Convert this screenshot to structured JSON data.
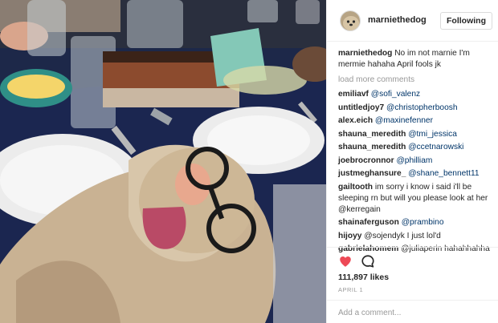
{
  "post": {
    "username": "marniethedog",
    "follow_label": "Following",
    "avatar_icon": "dog-avatar-icon",
    "caption": {
      "user": "marniethedog",
      "text": "No im not marnie I'm mermie hahaha April fools jk"
    },
    "load_more": "load more comments",
    "comments": [
      {
        "user": "emiliavf",
        "text": "@sofi_valenz"
      },
      {
        "user": "untitledjoy7",
        "text": "@christopherboosh"
      },
      {
        "user": "alex.eich",
        "text": "@maxinefenner"
      },
      {
        "user": "shauna_meredith",
        "text": "@tmi_jessica"
      },
      {
        "user": "shauna_meredith",
        "text": "@ccetnarowski"
      },
      {
        "user": "joebrocronnor",
        "text": "@philliam"
      },
      {
        "user": "justmeghansure_",
        "text": "@shane_bennett11"
      },
      {
        "user": "gailtooth",
        "text": "im sorry i know i said i'll be sleeping rn but will you please look at her @kerregain"
      },
      {
        "user": "shainaferguson",
        "text": "@prambino"
      },
      {
        "user": "hijoyy",
        "text": "@sojendyk I just lol'd"
      },
      {
        "user": "gabrielahomem",
        "text": "@juliaperin hahahhahha"
      }
    ],
    "likes": "111,897 likes",
    "date": "APRIL 1",
    "add_comment_placeholder": "Add a comment...",
    "like_icon": "heart-icon",
    "comment_icon": "speech-bubble-icon",
    "colors": {
      "heart": "#ed4956",
      "mention": "#003569",
      "muted": "#999999"
    }
  }
}
